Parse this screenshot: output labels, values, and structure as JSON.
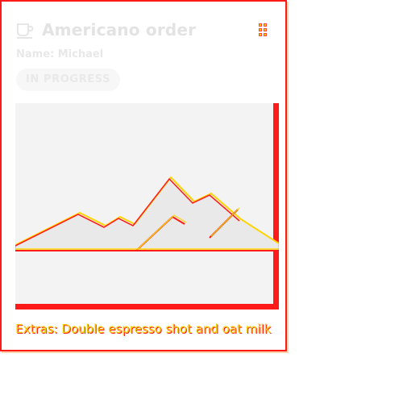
{
  "card": {
    "title": "Americano order",
    "icon": "coffee-cup-icon",
    "customer": "Name: Michael",
    "status": "IN PROGRESS",
    "image_icon": "image-placeholder-icon",
    "extras": "Extras: Double espresso shot and oat milk"
  },
  "colors": {
    "outline_red": "#ff1a1a",
    "outline_yellow": "#ffd400",
    "muted_text": "#e3e3e3",
    "image_background": "#f3f3f3"
  }
}
